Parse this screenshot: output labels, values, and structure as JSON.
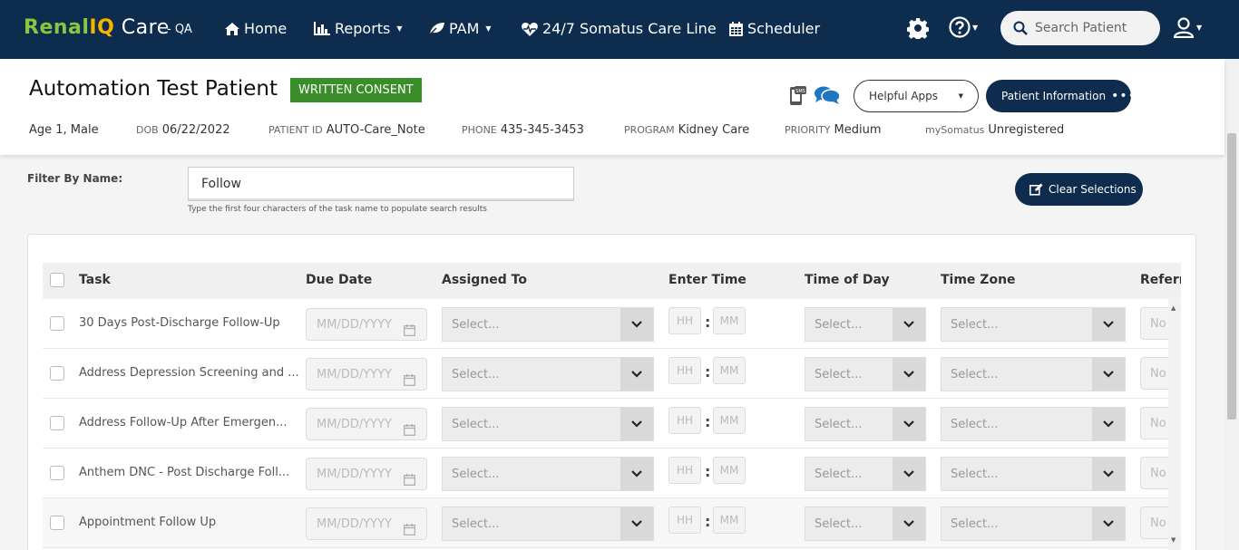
{
  "app": {
    "logo": {
      "renal": "Renal",
      "iq": "IQ",
      "care": " Care"
    },
    "env": "- QA"
  },
  "nav": {
    "home": "Home",
    "reports": "Reports",
    "pam": "PAM",
    "careline": "24/7 Somatus Care Line",
    "scheduler": "Scheduler",
    "search_placeholder": "Search Patient"
  },
  "patient": {
    "name": "Automation Test Patient",
    "consent": "WRITTEN CONSENT",
    "age_sex": "Age 1, Male",
    "dob_label": "DOB",
    "dob": "06/22/2022",
    "id_label": "PATIENT ID",
    "id": "AUTO-Care_Note",
    "phone_label": "PHONE",
    "phone": "435-345-3453",
    "program_label": "PROGRAM",
    "program": "Kidney Care",
    "priority_label": "PRIORITY",
    "priority": "Medium",
    "mysomatus_label": "mySomatus",
    "mysomatus": "Unregistered"
  },
  "actions": {
    "helpful_apps": "Helpful Apps",
    "patient_information": "Patient Information",
    "dots": "•••",
    "clear_selections": "Clear Selections",
    "sms_icon_text": "SMS"
  },
  "filter": {
    "label": "Filter By Name:",
    "value": "Follow",
    "hint": "Type the first four characters of the task name to populate search results"
  },
  "table": {
    "headers": {
      "task": "Task",
      "due_date": "Due Date",
      "assigned_to": "Assigned To",
      "enter_time": "Enter Time",
      "time_of_day": "Time of Day",
      "time_zone": "Time Zone",
      "referral": "Referra"
    },
    "placeholders": {
      "date": "MM/DD/YYYY",
      "select": "Select...",
      "hh": "HH",
      "mm": "MM",
      "colon": ":",
      "ref": "No"
    },
    "rows": [
      {
        "task": "30 Days Post-Discharge Follow-Up"
      },
      {
        "task": "Address Depression Screening and ..."
      },
      {
        "task": "Address Follow-Up After Emergen..."
      },
      {
        "task": "Anthem DNC - Post Discharge Foll..."
      },
      {
        "task": "Appointment Follow Up"
      }
    ]
  },
  "colors": {
    "navbar": "#0d2c4e",
    "consent_badge": "#3a8e2a",
    "logo_green": "#8cc63f",
    "logo_gold": "#f4b400"
  }
}
